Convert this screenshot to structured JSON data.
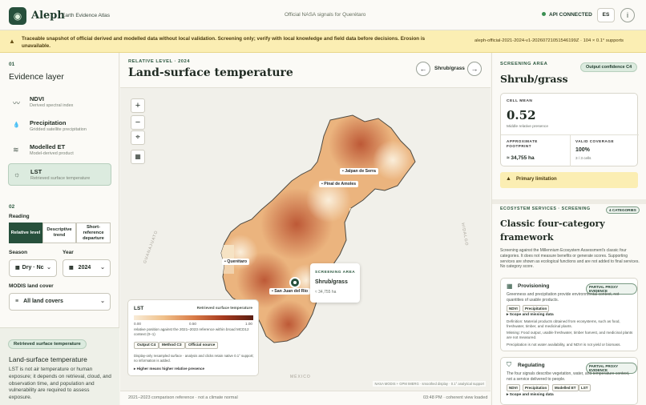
{
  "header": {
    "logo_glyph": "◉",
    "brand": "Aleph",
    "subtitle": "Earth Evidence Atlas",
    "center": "Official NASA signals for Querétaro",
    "api_status": "API CONNECTED",
    "lang": "ES",
    "info_glyph": "i"
  },
  "warning": {
    "icon": "▲",
    "text": "Traceable snapshot of official derived and modelled data without local validation. Screening only; verify with local knowledge and field data before decisions. Erosion is unavailable.",
    "snapshot": "aleph-official-2021-2024-v1-20260721051546199Z · 104 × 0.1° supports"
  },
  "left": {
    "step1": "01",
    "evidence_title": "Evidence layer",
    "layers": [
      {
        "icon": "〰",
        "title": "NDVI",
        "sub": "Derived spectral index"
      },
      {
        "icon": "💧",
        "title": "Precipitation",
        "sub": "Gridded satellite precipitation"
      },
      {
        "icon": "≋",
        "title": "Modelled ET",
        "sub": "Model-derived product"
      },
      {
        "icon": "☼",
        "title": "LST",
        "sub": "Retrieved surface temperature"
      }
    ],
    "step2": "02",
    "reading_label": "Reading",
    "reading_options": [
      "Relative level",
      "Descriptive trend",
      "Short-reference departure"
    ],
    "season_label": "Season",
    "season_value": "Dry · Nc",
    "year_label": "Year",
    "year_value": "2024",
    "modis_label": "MODIS land cover",
    "modis_value": "All land covers",
    "note_pill": "Retrieved surface temperature",
    "note_title": "Land-surface temperature",
    "note_text": "LST is not air temperature or human exposure; it depends on retrieval, cloud, and observation time, and population and vulnerability are required to assess exposure."
  },
  "main": {
    "kicker": "RELATIVE LEVEL · 2024",
    "title": "Land-surface temperature",
    "nav_label": "Shrub/grass",
    "prev": "←",
    "next": "→",
    "zoom_in": "+",
    "zoom_out": "−",
    "locate": "⌖",
    "layers_btn": "▦",
    "cities": [
      "Jalpan de Serra",
      "Pinal de Amoles",
      "Querétaro",
      "San Juan del Río"
    ],
    "states": [
      "GUANAJUATO",
      "HIDALGO",
      "MÉXICO"
    ],
    "popup": {
      "kicker": "SCREENING AREA",
      "title": "Shrub/grass",
      "value": "≈ 34,755 ha"
    },
    "legend": {
      "title": "LST",
      "subtitle": "Retrieved surface temperature",
      "min": "0.00",
      "mid": "0.50",
      "max": "1.00",
      "desc": "relative position against the 2021–2023 reference within broad MCD12 context (0–1)",
      "chips": [
        "Output C4",
        "Method C3",
        "Official source"
      ],
      "note": "Display-only resampled surface · analysis and clicks retain native 0.1° support; no information is added.",
      "foot": "▸ Higher means higher relative presence"
    },
    "attribution": "NASA MODIS + GPM IMERG · smoothed display · 0.1° analytical support",
    "footer_left": "2021–2023 comparison reference · not a climate normal",
    "footer_right": "03:48 PM · coherent view loaded"
  },
  "right": {
    "kicker": "SCREENING AREA",
    "confidence": "Output confidence C4",
    "title": "Shrub/grass",
    "cell_label": "CELL MEAN",
    "cell_value": "0.52",
    "cell_sub": "Middle relative presence",
    "foot_label": "APPROXIMATE FOOTPRINT",
    "foot_value": "≈ 34,755 ha",
    "cov_label": "VALID COVERAGE",
    "cov_value": "100%",
    "cov_sub": "3 / 3 cells",
    "limitation": "Primary limitation",
    "eco_kicker": "ECOSYSTEM SERVICES · SCREENING",
    "eco_badge": "4 CATEGORIES",
    "eco_title": "Classic four-category framework",
    "eco_text": "Screening against the Millennium Ecosystem Assessment's classic four categories. It does not measure benefits or generate scores. Supporting services are shown as ecological functions and are not added to final services. No category score.",
    "services": [
      {
        "icon": "▦",
        "name": "Provisioning",
        "badge": "PARTIAL PROXY EVIDENCE",
        "desc": "Greenness and precipitation provide environmental context, not quantities of usable products.",
        "tags": [
          "NDVI",
          "Precipitation"
        ],
        "scope": "▸ Scope and missing data",
        "def": "Definition: Material products obtained from ecosystems, such as food, freshwater, timber, and medicinal plants.",
        "missing": "Missing: Food output, usable freshwater, timber harvest, and medicinal plants are not measured.",
        "extra": "Precipitation is not water availability, and NDVI is not yield or biomass."
      },
      {
        "icon": "⛉",
        "name": "Regulating",
        "badge": "PARTIAL PROXY EVIDENCE",
        "desc": "The four signals describe vegetation, water, and temperature context, not a service delivered to people.",
        "tags": [
          "NDVI",
          "Precipitation",
          "Modelled ET",
          "LST"
        ],
        "scope": "▸ Scope and missing data"
      }
    ]
  },
  "colors": {
    "accent": "#27503c",
    "warn_bg": "#fbeeb3",
    "heat_low": "#f6e3c4",
    "heat_high": "#a63a1f"
  }
}
